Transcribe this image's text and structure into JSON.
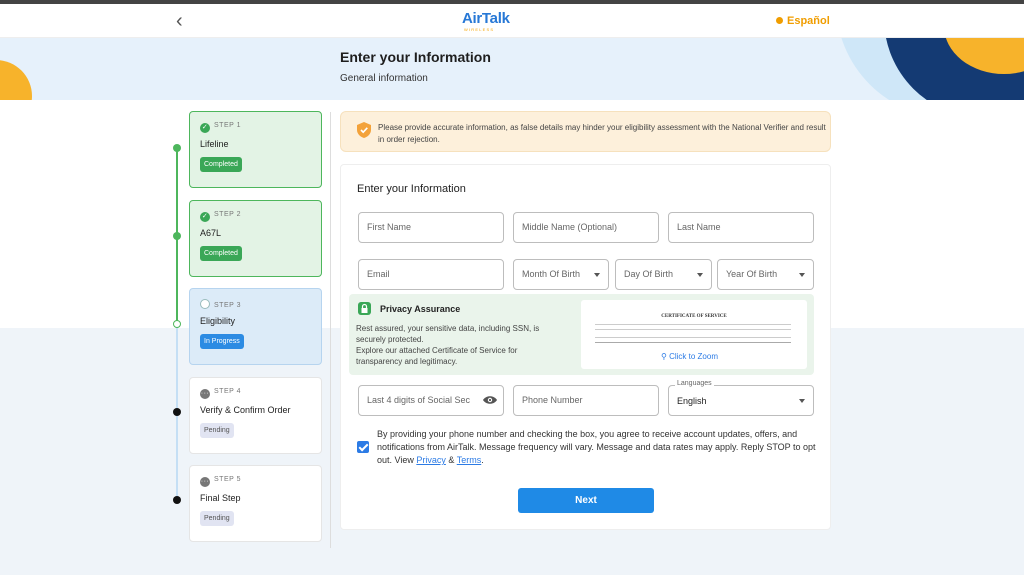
{
  "header": {
    "logo_text": "AirTalk",
    "logo_sub": "WIRELESS",
    "language_link": "Español"
  },
  "banner": {
    "title": "Enter your Information",
    "subtitle": "General information"
  },
  "steps": [
    {
      "label": "STEP 1",
      "title": "Lifeline",
      "status": "Completed"
    },
    {
      "label": "STEP 2",
      "title": "A67L",
      "status": "Completed"
    },
    {
      "label": "STEP 3",
      "title": "Eligibility",
      "status": "In Progress"
    },
    {
      "label": "STEP 4",
      "title": "Verify & Confirm Order",
      "status": "Pending"
    },
    {
      "label": "STEP 5",
      "title": "Final Step",
      "status": "Pending"
    }
  ],
  "alert": {
    "text": "Please provide accurate information, as false details may hinder your eligibility assessment with the National Verifier and result in order rejection."
  },
  "form": {
    "title": "Enter your Information",
    "first_name_placeholder": "First Name",
    "middle_name_placeholder": "Middle Name (Optional)",
    "last_name_placeholder": "Last Name",
    "email_placeholder": "Email",
    "month_placeholder": "Month Of Birth",
    "day_placeholder": "Day Of Birth",
    "year_placeholder": "Year Of Birth",
    "ssn_placeholder": "Last 4 digits of Social Sec",
    "phone_placeholder": "Phone Number",
    "languages_label": "Languages",
    "language_value": "English"
  },
  "privacy": {
    "title": "Privacy Assurance",
    "text1": "Rest assured, your sensitive data, including SSN, is securely protected.",
    "text2": "Explore our attached Certificate of Service for transparency and legitimacy.",
    "certificate_title": "CERTIFICATE OF SERVICE",
    "zoom_label": "Click to Zoom"
  },
  "consent": {
    "text": "By providing your phone number and checking the box, you agree to receive account updates, offers, and notifications from AirTalk. Message frequency will vary. Message and data rates may apply. Reply STOP to opt out. View ",
    "privacy_link": "Privacy",
    "amp": " & ",
    "terms_link": "Terms",
    "end": ".",
    "checked": true
  },
  "next_button": "Next",
  "colors": {
    "brand_blue": "#2778d6",
    "accent_orange": "#f7b32b",
    "success_green": "#3aa757",
    "button_blue": "#1f8ae6"
  }
}
